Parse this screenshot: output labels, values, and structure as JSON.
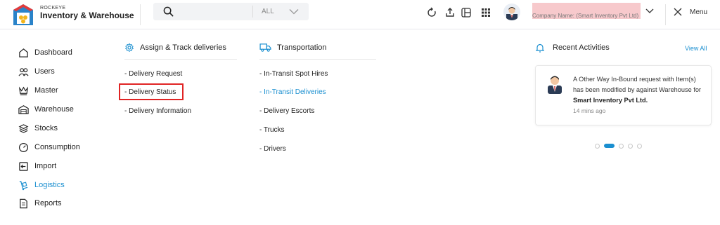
{
  "brand": {
    "small": "ROCKEYE",
    "name": "Inventory & Warehouse"
  },
  "search": {
    "value": "",
    "category": "ALL"
  },
  "header": {
    "icons": [
      "refresh-icon",
      "upload-icon",
      "layout-icon",
      "apps-grid-icon"
    ],
    "company_name": "Company Name: (Smart Inventory Pvt Ltd)",
    "menu_label": "Menu"
  },
  "sidebar": {
    "items": [
      {
        "label": "Dashboard",
        "icon": "home-icon"
      },
      {
        "label": "Users",
        "icon": "users-icon"
      },
      {
        "label": "Master",
        "icon": "crown-icon"
      },
      {
        "label": "Warehouse",
        "icon": "warehouse-icon"
      },
      {
        "label": "Stocks",
        "icon": "layers-icon"
      },
      {
        "label": "Consumption",
        "icon": "gauge-icon"
      },
      {
        "label": "Import",
        "icon": "import-icon"
      },
      {
        "label": "Logistics",
        "icon": "logistics-icon"
      },
      {
        "label": "Reports",
        "icon": "report-icon"
      }
    ],
    "active": "Logistics"
  },
  "assign": {
    "title": "Assign & Track deliveries",
    "links": [
      "- Delivery Request",
      "- Delivery Status",
      "- Delivery Information"
    ]
  },
  "transport": {
    "title": "Transportation",
    "links": [
      "- In-Transit Spot Hires",
      "- In-Transit Deliveries",
      "- Delivery Escorts",
      "- Trucks",
      "- Drivers"
    ],
    "active_link": "- In-Transit Deliveries"
  },
  "recent": {
    "title": "Recent Activities",
    "view_all": "View All",
    "activity_text": "A Other Way In-Bound request with Item(s) has been modified by against Warehouse for",
    "activity_company": "Smart Inventory Pvt Ltd.",
    "time": "14 mins ago",
    "carousel_pages": 5,
    "carousel_active": 2
  },
  "colors": {
    "accent": "#1a8fd0",
    "highlight": "#e02424",
    "logo_red": "#e23b3b",
    "logo_blue": "#2a83c9",
    "logo_yellow": "#f3b51b"
  }
}
